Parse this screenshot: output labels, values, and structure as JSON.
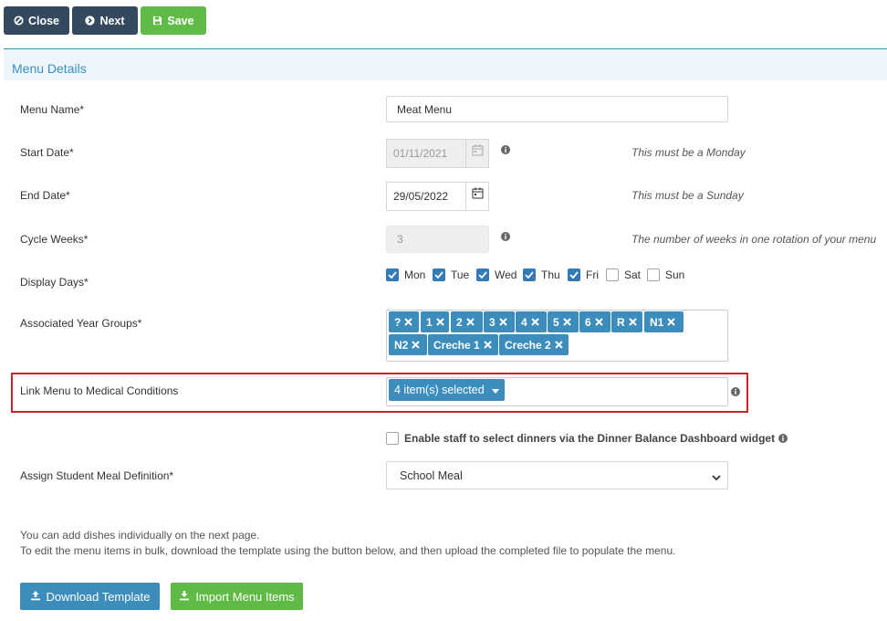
{
  "toolbar": {
    "close_label": "Close",
    "next_label": "Next",
    "save_label": "Save",
    "close_icon": "ban-icon",
    "next_icon": "arrow-circle-right-icon",
    "save_icon": "floppy-icon"
  },
  "panel": {
    "title": "Menu Details"
  },
  "form": {
    "menu_name": {
      "label": "Menu Name*",
      "value": "Meat Menu"
    },
    "start_date": {
      "label": "Start Date*",
      "value": "01/11/2021",
      "hint": "This must be a Monday",
      "disabled": true
    },
    "end_date": {
      "label": "End Date*",
      "value": "29/05/2022",
      "hint": "This must be a Sunday"
    },
    "cycle_weeks": {
      "label": "Cycle Weeks*",
      "value": "3",
      "hint": "The number of weeks in one rotation of your menu",
      "disabled": true
    },
    "display_days": {
      "label": "Display Days*",
      "days": [
        {
          "label": "Mon",
          "checked": true
        },
        {
          "label": "Tue",
          "checked": true
        },
        {
          "label": "Wed",
          "checked": true
        },
        {
          "label": "Thu",
          "checked": true
        },
        {
          "label": "Fri",
          "checked": true
        },
        {
          "label": "Sat",
          "checked": false
        },
        {
          "label": "Sun",
          "checked": false
        }
      ]
    },
    "year_groups": {
      "label": "Associated Year Groups*",
      "tags": [
        "?",
        "1",
        "2",
        "3",
        "4",
        "5",
        "6",
        "R",
        "N1",
        "N2",
        "Creche 1",
        "Creche 2"
      ]
    },
    "medical_conditions": {
      "label": "Link Menu to Medical Conditions",
      "value": "4 item(s) selected"
    },
    "enable_staff": {
      "label": "Enable staff to select dinners via the Dinner Balance Dashboard widget",
      "checked": false
    },
    "meal_definition": {
      "label": "Assign Student Meal Definition*",
      "value": "School Meal"
    }
  },
  "notes": {
    "line1": "You can add dishes individually on the next page.",
    "line2": "To edit the menu items in bulk, download the template using the button below, and then upload the completed file to populate the menu."
  },
  "actions": {
    "download_label": "Download Template",
    "import_label": "Import Menu Items"
  },
  "colors": {
    "toolbar_dark": "#34495e",
    "success": "#5fbb46",
    "primary": "#3c8dbc",
    "checkbox": "#337ab7",
    "highlight": "#cc2229"
  }
}
